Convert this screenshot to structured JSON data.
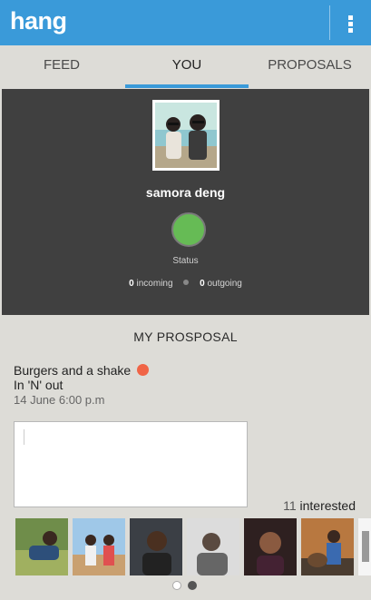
{
  "app": {
    "title": "hang",
    "menu_icon": "overflow-menu-icon"
  },
  "tabs": [
    {
      "label": "FEED",
      "active": false
    },
    {
      "label": "YOU",
      "active": true
    },
    {
      "label": "PROPOSALS",
      "active": false
    }
  ],
  "profile": {
    "name": "samora deng",
    "status_label": "Status",
    "status_color": "#66bb55",
    "incoming_count": "0",
    "incoming_label": "incoming",
    "outgoing_count": "0",
    "outgoing_label": "outgoing"
  },
  "proposal": {
    "section_title": "MY PROSPOSAL",
    "name": "Burgers and a shake",
    "place": "In 'N' out",
    "date": "14 June 6:00 p.m",
    "indicator_color": "#f06446",
    "comment_value": "",
    "interested_count": "11",
    "interested_label": "interested"
  },
  "interested_photos": [
    "person-photo-1",
    "person-photo-2",
    "person-photo-3",
    "person-photo-4",
    "person-photo-5",
    "person-photo-6",
    "person-photo-7"
  ],
  "pager": {
    "pages": 2,
    "current": 2
  },
  "colors": {
    "primary": "#3a9ad9",
    "background": "#dddcd7",
    "profile_bg": "#404040"
  }
}
